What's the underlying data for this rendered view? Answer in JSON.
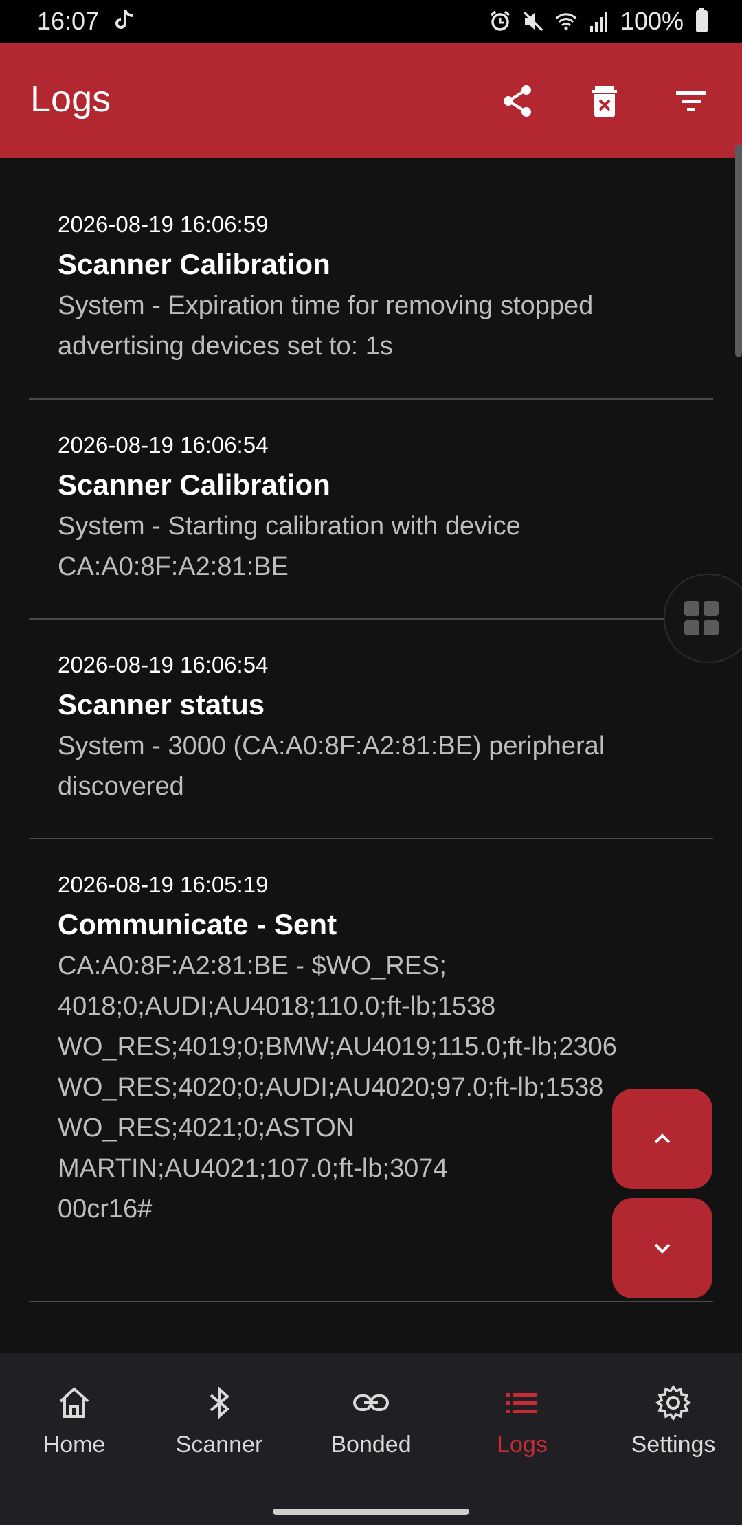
{
  "status_bar": {
    "time": "16:07",
    "battery": "100%"
  },
  "app_bar": {
    "title": "Logs",
    "actions": [
      "share-icon",
      "delete-icon",
      "filter-icon"
    ]
  },
  "logs": [
    {
      "timestamp": "2026-08-19 16:06:59",
      "title": "Scanner Calibration",
      "message": "System - Expiration time for removing stopped\nadvertising devices set to: 1s"
    },
    {
      "timestamp": "2026-08-19 16:06:54",
      "title": "Scanner Calibration",
      "message": "System - Starting calibration with device\nCA:A0:8F:A2:81:BE"
    },
    {
      "timestamp": "2026-08-19 16:06:54",
      "title": "Scanner status",
      "message": "System - 3000 (CA:A0:8F:A2:81:BE) peripheral\ndiscovered"
    },
    {
      "timestamp": "2026-08-19 16:05:19",
      "title": "Communicate - Sent",
      "message": "CA:A0:8F:A2:81:BE - $WO_RES;\n4018;0;AUDI;AU4018;110.0;ft-lb;1538\nWO_RES;4019;0;BMW;AU4019;115.0;ft-lb;2306\nWO_RES;4020;0;AUDI;AU4020;97.0;ft-lb;1538\nWO_RES;4021;0;ASTON\nMARTIN;AU4021;107.0;ft-lb;3074\n00cr16#"
    }
  ],
  "fab": {
    "scroll_up": "chevron-up-icon",
    "scroll_down": "chevron-down-icon"
  },
  "bottom_nav": {
    "items": [
      {
        "label": "Home",
        "icon": "home-icon",
        "active": false
      },
      {
        "label": "Scanner",
        "icon": "bluetooth-icon",
        "active": false
      },
      {
        "label": "Bonded",
        "icon": "link-icon",
        "active": false
      },
      {
        "label": "Logs",
        "icon": "list-icon",
        "active": true
      },
      {
        "label": "Settings",
        "icon": "gear-icon",
        "active": false
      }
    ]
  },
  "colors": {
    "accent": "#b32830",
    "active_nav": "#c82a33",
    "background": "#121213",
    "nav_background": "#202024"
  }
}
